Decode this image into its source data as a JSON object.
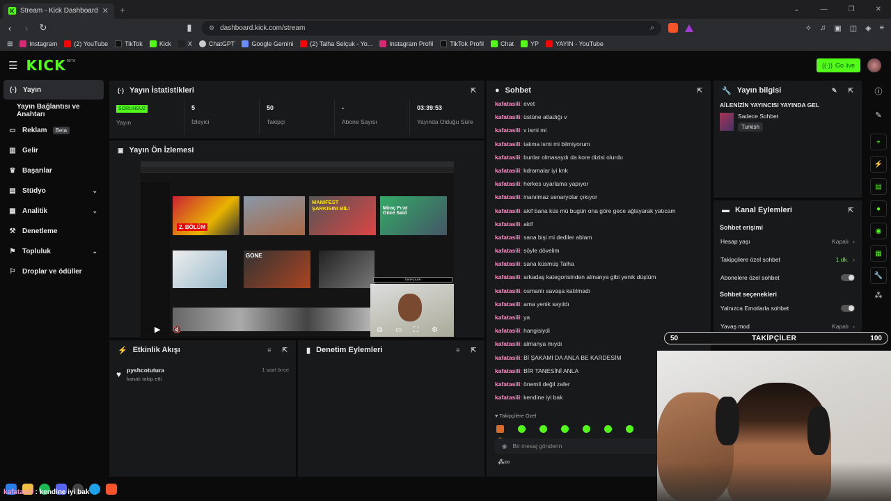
{
  "browser": {
    "tab_title": "Stream - Kick Dashboard",
    "url": "dashboard.kick.com/stream",
    "bookmarks": [
      "Instagram",
      "(2) YouTube",
      "TikTok",
      "Kick",
      "X",
      "ChatGPT",
      "Google Gemini",
      "(2) Talha Selçuk - Yo...",
      "Instagram Profil",
      "TikTok Profil",
      "Chat",
      "YP",
      "YAYIN - YouTube"
    ]
  },
  "app": {
    "logo": "KICK",
    "logo_tag": "BETA",
    "go_live": "Go live"
  },
  "sidebar": {
    "items": [
      {
        "label": "Yayın",
        "icon": "broadcast-icon"
      },
      {
        "label": "Yayın Bağlantısı ve Anahtarı",
        "icon": ""
      },
      {
        "label": "Reklam",
        "icon": "ads-icon",
        "badge": "Beta"
      },
      {
        "label": "Gelir",
        "icon": "revenue-icon"
      },
      {
        "label": "Başarılar",
        "icon": "trophy-icon"
      },
      {
        "label": "Stüdyo",
        "icon": "studio-icon"
      },
      {
        "label": "Analitik",
        "icon": "analytics-icon"
      },
      {
        "label": "Denetleme",
        "icon": "moderation-icon"
      },
      {
        "label": "Topluluk",
        "icon": "community-icon"
      },
      {
        "label": "Droplar ve ödüller",
        "icon": "drops-icon"
      }
    ]
  },
  "stats_panel": {
    "title": "Yayın İstatistikleri",
    "status_badge": "SORUNSUZ",
    "stats": [
      {
        "value": "",
        "label": "Yayın"
      },
      {
        "value": "5",
        "label": "İzleyici"
      },
      {
        "value": "50",
        "label": "Takipçi"
      },
      {
        "value": "-",
        "label": "Abone Sayısı"
      },
      {
        "value": "03:39:53",
        "label": "Yayında Olduğu Süre"
      }
    ]
  },
  "preview_panel": {
    "title": "Yayın Ön İzlemesi",
    "thumb_texts": [
      "2. BÖLÜM",
      "MANIFEST ŞARKISINI BİL!",
      "Miraç Fırat Once Said",
      "GONE",
      "TAKİPÇİLER"
    ]
  },
  "activity_panel": {
    "title": "Etkinlik Akışı",
    "events": [
      {
        "user": "pyshcotutura",
        "action": "kanalı takip etti",
        "time": "1 saat önce"
      }
    ]
  },
  "mod_panel": {
    "title": "Denetim Eylemleri"
  },
  "chat": {
    "title": "Sohbet",
    "messages": [
      {
        "user": "kafatasili",
        "text": "evet"
      },
      {
        "user": "kafatasili",
        "text": "üstüne atladığı v"
      },
      {
        "user": "kafatasili",
        "text": "v ismi mi"
      },
      {
        "user": "kafatasili",
        "text": "takma ismi mi bilmiyorum"
      },
      {
        "user": "kafatasili",
        "text": "bunlar olmasaydı da kore dizisi olurdu"
      },
      {
        "user": "kafatasili",
        "text": "kdramalar iyi knk"
      },
      {
        "user": "kafatasili",
        "text": "herkes uyarlama yapıyor"
      },
      {
        "user": "kafatasili",
        "text": "inanılmaz senaryolar çıkıyor"
      },
      {
        "user": "kafatasili",
        "text": "akif bana küs mü bugün ona göre gece ağlayarak yatıcam"
      },
      {
        "user": "kafatasili",
        "text": "akif"
      },
      {
        "user": "kafatasili",
        "text": "sana bişi mi dediler ablam"
      },
      {
        "user": "kafatasili",
        "text": "söyle dövelim"
      },
      {
        "user": "kafatasili",
        "text": "sana küsmüş Talha"
      },
      {
        "user": "kafatasili",
        "text": "arkadaş kategorisinden almanya gibi yenik düştüm"
      },
      {
        "user": "kafatasili",
        "text": "osmanlı savaşa katılmadı"
      },
      {
        "user": "kafatasili",
        "text": "ama yenik sayıldı"
      },
      {
        "user": "kafatasili",
        "text": "ya"
      },
      {
        "user": "kafatasili",
        "text": "hangisiydi"
      },
      {
        "user": "kafatasili",
        "text": "almanya mıydı"
      },
      {
        "user": "kafatasili",
        "text": "Bİ ŞAKAMI DA ANLA BE KARDESİM"
      },
      {
        "user": "kafatasili",
        "text": "BİR TANESİNİ ANLA"
      },
      {
        "user": "kafatasili",
        "text": "önemli değil zafer"
      },
      {
        "user": "kafatasili",
        "text": "kendine iyi bak"
      }
    ],
    "followers_only": "Takipçilere Özel",
    "input_placeholder": "Bir mesaj gönderin"
  },
  "stream_info": {
    "title": "Yayın bilgisi",
    "stream_title": "AİLENİZİN YAYINCISI YAYINDA GEL",
    "category": "Sadece Sohbet",
    "language": "Turkish"
  },
  "channel_actions": {
    "title": "Kanal Eylemleri",
    "section1": "Sohbet erişimi",
    "rows": [
      {
        "label": "Hesap yaşı",
        "value": "Kapalı"
      },
      {
        "label": "Takipçilere özel sohbet",
        "value": "1 dk."
      },
      {
        "label": "Abonelere özel sohbet",
        "value": ""
      }
    ],
    "section2": "Sohbet seçenekleri",
    "rows2": [
      {
        "label": "Yalnızca Emotlarla sohbet",
        "value": ""
      },
      {
        "label": "Yavaş mod",
        "value": "Kapalı"
      }
    ]
  },
  "follower_goal": {
    "current": "50",
    "label": "TAKİPÇİLER",
    "target": "100"
  },
  "overlay_chat": {
    "user": "kafatasili",
    "text": "kendine iyi bak"
  },
  "colors": {
    "accent": "#53fc18",
    "username": "#ff8ec8",
    "panel": "#18191b"
  }
}
